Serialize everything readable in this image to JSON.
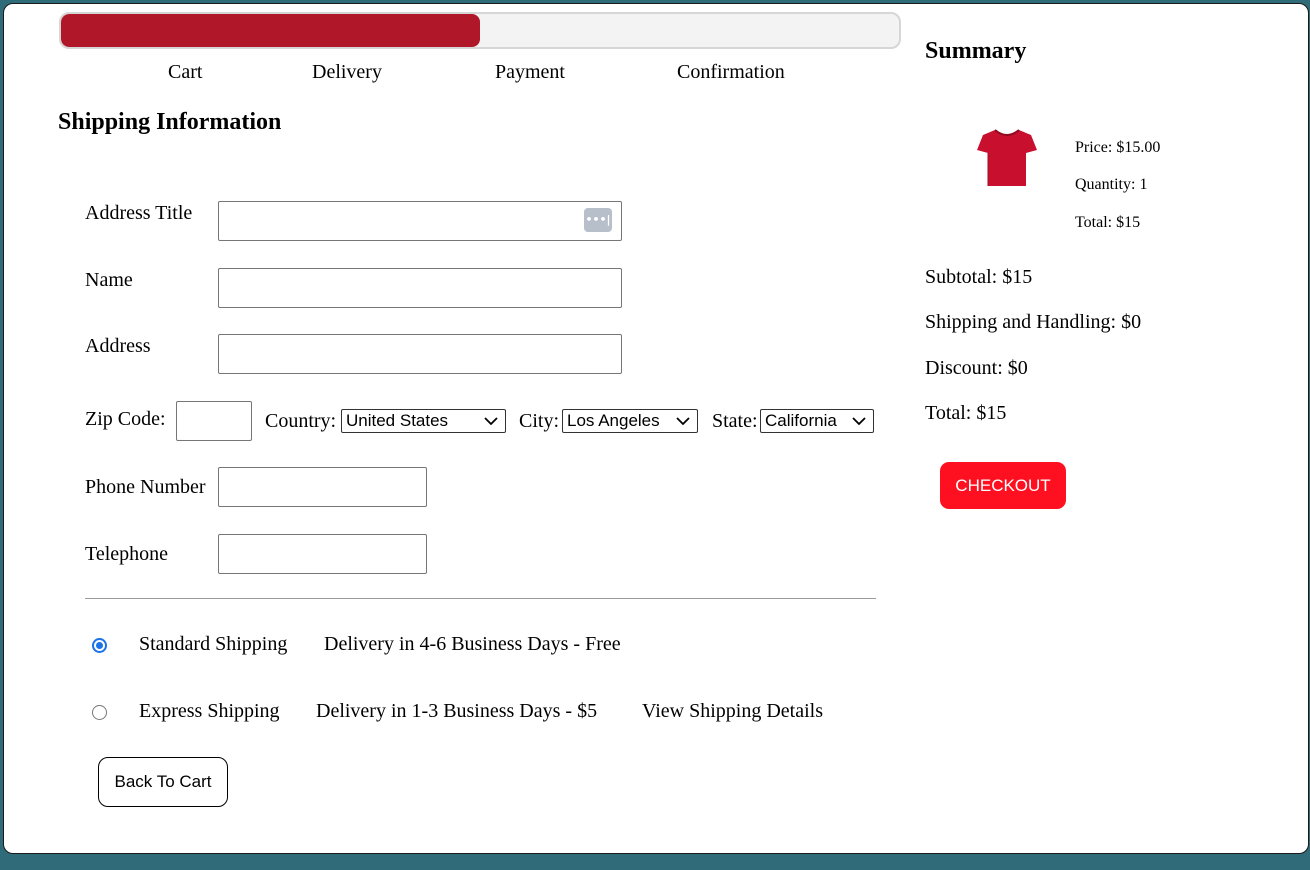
{
  "progress": {
    "percent": 50,
    "fill_color": "#b0182a",
    "steps": [
      "Cart",
      "Delivery",
      "Payment",
      "Confirmation"
    ]
  },
  "shipping": {
    "title": "Shipping Information",
    "fields": {
      "address_title": {
        "label": "Address Title",
        "value": ""
      },
      "name": {
        "label": "Name",
        "value": ""
      },
      "address": {
        "label": "Address",
        "value": ""
      },
      "zip": {
        "label": "Zip Code:",
        "value": ""
      },
      "phone": {
        "label": "Phone Number",
        "value": ""
      },
      "telephone": {
        "label": "Telephone",
        "value": ""
      }
    },
    "country": {
      "label": "Country:",
      "selected": "United States"
    },
    "city": {
      "label": "City:",
      "selected": "Los Angeles"
    },
    "state": {
      "label": "State:",
      "selected": "California"
    },
    "options": [
      {
        "name": "Standard Shipping",
        "desc": "Delivery in 4-6 Business Days - Free",
        "selected": true
      },
      {
        "name": "Express Shipping",
        "desc": "Delivery in 1-3 Business Days - $5",
        "link": "View Shipping Details",
        "selected": false
      }
    ],
    "back_label": "Back To Cart"
  },
  "summary": {
    "title": "Summary",
    "item": {
      "icon": "tshirt-image",
      "color": "#c8102e",
      "price": "Price: $15.00",
      "quantity": "Quantity: 1",
      "total": "Total: $15"
    },
    "subtotal": "Subtotal: $15",
    "shipping": "Shipping and Handling: $0",
    "discount": "Discount: $0",
    "total": "Total: $15",
    "checkout_label": "CHECKOUT",
    "checkout_color": "#ff1020"
  }
}
